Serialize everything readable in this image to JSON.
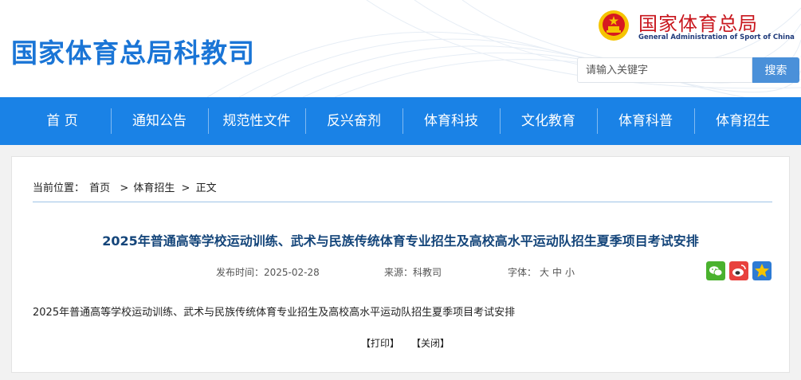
{
  "header": {
    "site_title": "国家体育总局科教司",
    "org_name_cn": "国家体育总局",
    "org_name_en": "General Administration of Sport of China",
    "search_placeholder": "请输入关键字",
    "search_button": "搜索"
  },
  "nav": {
    "items": [
      {
        "label": "首 页"
      },
      {
        "label": "通知公告"
      },
      {
        "label": "规范性文件"
      },
      {
        "label": "反兴奋剂"
      },
      {
        "label": "体育科技"
      },
      {
        "label": "文化教育"
      },
      {
        "label": "体育科普"
      },
      {
        "label": "体育招生"
      }
    ]
  },
  "breadcrumb": {
    "prefix": "当前位置：",
    "items": [
      "首页",
      "体育招生",
      "正文"
    ],
    "separator": ">"
  },
  "article": {
    "title": "2025年普通高等学校运动训练、武术与民族传统体育专业招生及高校高水平运动队招生夏季项目考试安排",
    "publish_label": "发布时间：",
    "publish_date": "2025-02-28",
    "source_label": "来源：",
    "source": "科教司",
    "font_label": "字体：",
    "font_large": "大",
    "font_medium": "中",
    "font_small": "小",
    "body": "2025年普通高等学校运动训练、武术与民族传统体育专业招生及高校高水平运动队招生夏季项目考试安排",
    "print": "【打印】",
    "close": "【关闭】"
  },
  "share": {
    "icons": [
      "wechat-icon",
      "weibo-icon",
      "favorite-icon"
    ]
  },
  "colors": {
    "nav_bg": "#1a82e6",
    "title_blue": "#1a75d6",
    "org_red": "#c8161d",
    "article_title": "#14457a",
    "search_button_bg": "#4a90d9"
  }
}
